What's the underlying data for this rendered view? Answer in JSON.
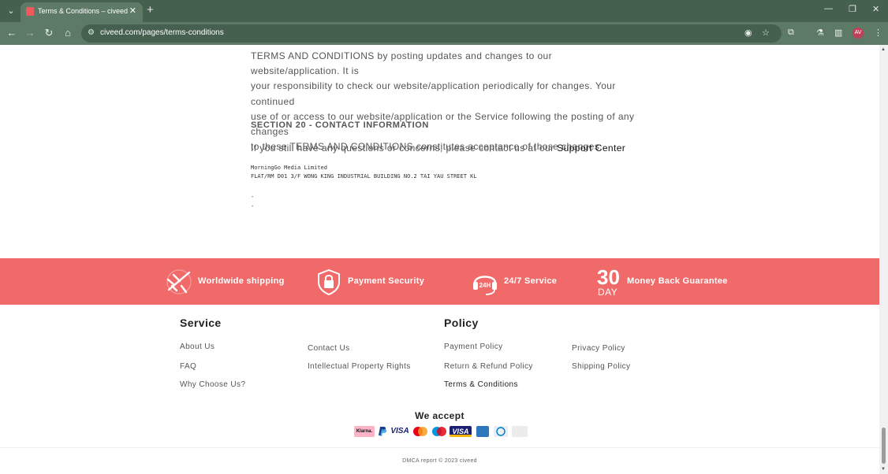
{
  "browser": {
    "tab_title": "Terms & Conditions – civeed",
    "url": "civeed.com/pages/terms-conditions",
    "profile_initials": "AV"
  },
  "content": {
    "paragraph_lines": [
      "TERMS AND CONDITIONS by posting updates and changes to our website/application. It is",
      "your responsibility to check our website/application periodically for changes. Your continued",
      "use of or access to our website/application or the Service following the posting of any changes",
      "to these TERMS AND CONDITIONS constitutes acceptance of those changes."
    ],
    "section_title": "SECTION 20 - CONTACT INFORMATION",
    "contact_text": "If you still have any questions or concerns, please contact us at our ",
    "support_link": "Support Center",
    "company_name": "MorningGo Media Limited",
    "company_address": "FLAT/RM D01 3/F WONG KING INDUSTRIAL BUILDING NO.2 TAI YAU STREET KL",
    "dash_1": "-",
    "dash_2": "-"
  },
  "banner": {
    "background_color": "#f06a6a",
    "features": [
      {
        "label": "Worldwide shipping",
        "icon": "airplane-icon"
      },
      {
        "label": "Payment Security",
        "icon": "shield-lock-icon"
      },
      {
        "label": "24/7 Service",
        "icon": "headset-24h-icon",
        "icon_text": "24H"
      },
      {
        "label": "Money Back Guarantee",
        "icon": "30-day-icon",
        "icon_number": "30",
        "icon_unit": "DAY"
      }
    ]
  },
  "footer": {
    "service_heading": "Service",
    "policy_heading": "Policy",
    "service_links": [
      "About Us",
      "Contact Us",
      "FAQ",
      "Intellectual Property Rights",
      "Why Choose Us?"
    ],
    "policy_links": [
      "Payment Policy",
      "Privacy Policy",
      "Return & Refund Policy",
      "Shipping Policy",
      "Terms & Conditions"
    ],
    "accept_title": "We accept",
    "payment_methods": [
      "Klarna.",
      "PayPal",
      "VISA",
      "Mastercard",
      "Maestro",
      "VISA",
      "American Express",
      "Diners Club",
      "Discover"
    ],
    "copyright": "DMCA report © 2023 civeed"
  }
}
